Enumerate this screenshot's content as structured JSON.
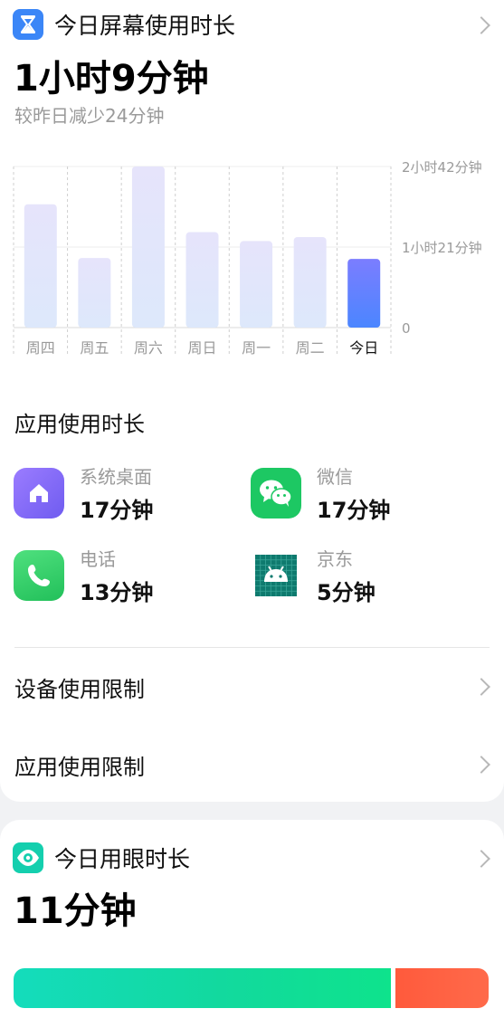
{
  "screen_time": {
    "title": "今日屏幕使用时长",
    "total": "1小时9分钟",
    "comparison": "较昨日减少24分钟",
    "icon": "hourglass-icon",
    "accent": "#3b86f7"
  },
  "chart_data": {
    "type": "bar",
    "categories": [
      "周四",
      "周五",
      "周六",
      "周日",
      "周一",
      "周二",
      "今日"
    ],
    "values": [
      124,
      70,
      162,
      96,
      87,
      91,
      69
    ],
    "y_tick_labels": [
      "2小时42分钟",
      "1小时21分钟",
      "0"
    ],
    "y_ticks_minutes": [
      162,
      81,
      0
    ],
    "ylim": [
      0,
      162
    ],
    "highlight_index": 6,
    "bar_color": "#e3e6fb",
    "highlight_color": "#6f7bff"
  },
  "app_usage": {
    "title": "应用使用时长",
    "apps": [
      {
        "name": "系统桌面",
        "time": "17分钟",
        "icon": "home-icon",
        "color": "#8a6cf6"
      },
      {
        "name": "微信",
        "time": "17分钟",
        "icon": "wechat-icon",
        "color": "#1dc863"
      },
      {
        "name": "电话",
        "time": "13分钟",
        "icon": "phone-icon",
        "color": "#2ecc61"
      },
      {
        "name": "京东",
        "time": "5分钟",
        "icon": "android-icon",
        "color": "#0e7a6e"
      }
    ]
  },
  "device_limit": {
    "label": "设备使用限制"
  },
  "app_limit": {
    "label": "应用使用限制"
  },
  "eye_time": {
    "title": "今日用眼时长",
    "total": "11分钟",
    "icon": "eye-icon",
    "accent": "#14cfae",
    "segments": [
      {
        "fraction": 0.78,
        "color": "#16d6a2"
      },
      {
        "fraction": 0.195,
        "color": "#ff5a3c"
      }
    ]
  }
}
